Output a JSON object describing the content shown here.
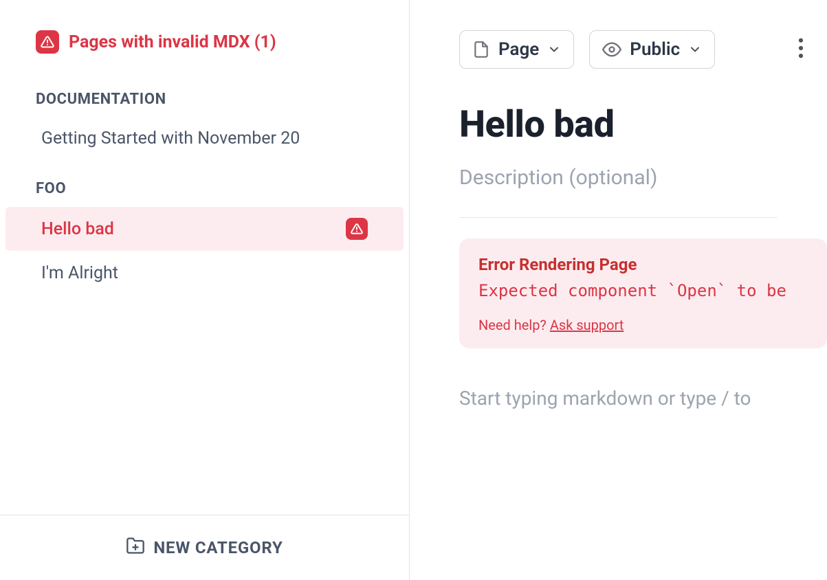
{
  "sidebar": {
    "invalid_warning_label": "Pages with invalid MDX (1)",
    "categories": [
      {
        "heading": "DOCUMENTATION",
        "pages": [
          {
            "label": "Getting Started with November 20",
            "selected": false,
            "has_error": false
          }
        ]
      },
      {
        "heading": "FOO",
        "pages": [
          {
            "label": "Hello bad",
            "selected": true,
            "has_error": true
          },
          {
            "label": "I'm Alright",
            "selected": false,
            "has_error": false
          }
        ]
      }
    ],
    "new_category_label": "NEW CATEGORY"
  },
  "toolbar": {
    "page_type_label": "Page",
    "visibility_label": "Public"
  },
  "page": {
    "title": "Hello bad",
    "description_placeholder": "Description (optional)",
    "body_placeholder": "Start typing markdown or type / to"
  },
  "error": {
    "heading": "Error Rendering Page",
    "message": "Expected component `Open` to be",
    "help_prefix": "Need help? ",
    "help_link_label": "Ask support"
  }
}
